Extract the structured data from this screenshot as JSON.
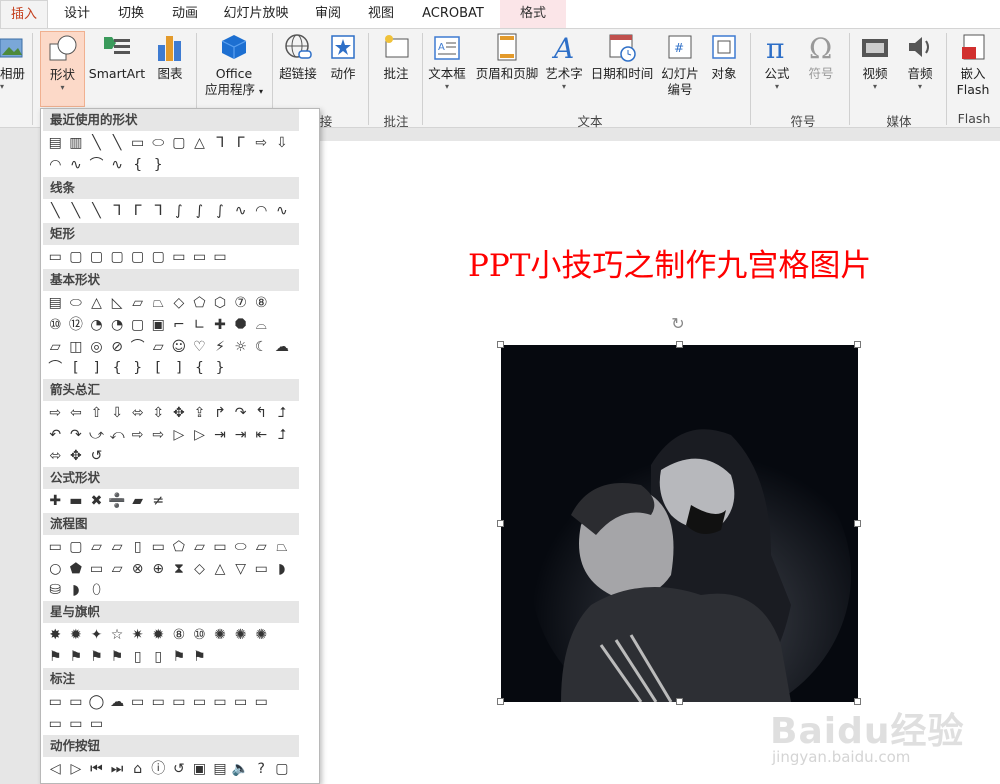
{
  "tabs": [
    {
      "label": "插入"
    },
    {
      "label": "设计"
    },
    {
      "label": "切换"
    },
    {
      "label": "动画"
    },
    {
      "label": "幻灯片放映"
    },
    {
      "label": "审阅"
    },
    {
      "label": "视图"
    },
    {
      "label": "ACROBAT"
    },
    {
      "label": "格式"
    }
  ],
  "ribbon": {
    "album": "相册",
    "shapes": "形状",
    "smartart": "SmartArt",
    "chart": "图表",
    "office_apps_1": "Office",
    "office_apps_2": "应用程序",
    "hyperlink": "超链接",
    "action": "动作",
    "comment": "批注",
    "textbox": "文本框",
    "header_footer": "页眉和页脚",
    "wordart": "艺术字",
    "datetime": "日期和时间",
    "slidenum_1": "幻灯片",
    "slidenum_2": "编号",
    "object": "对象",
    "equation": "公式",
    "symbol": "符号",
    "video": "视频",
    "audio": "音频",
    "embed_1": "嵌入",
    "embed_2": "Flash",
    "groups": {
      "links": "接",
      "comments": "批注",
      "text": "文本",
      "symbols": "符号",
      "media": "媒体",
      "flash": "Flash"
    }
  },
  "slide": {
    "title": "PPT小技巧之制作九宫格图片"
  },
  "watermark": {
    "logo": "Baidu经验",
    "url": "jingyan.baidu.com"
  },
  "shapes_panel": {
    "recent": {
      "title": "最近使用的形状",
      "rows": [
        "▤▥╲╲▭⬭▢△ᒣᒥ⇨⇩",
        "◠∿⌒∿{ }"
      ]
    },
    "lines": {
      "title": "线条",
      "rows": [
        "╲╲╲ᒣᒥᒣ∫∫∫∿◠∿"
      ]
    },
    "rect": {
      "title": "矩形",
      "rows": [
        "▭▢▢▢▢▢▭▭▭"
      ]
    },
    "basic": {
      "title": "基本形状",
      "rows": [
        "▤⬭△◺▱⏢◇⬠⬡⑦⑧",
        "⑩⑫◔◔▢▣⌐∟✚⯃⌓",
        "▱◫◎⊘⌒▱☺♡⚡☼☾☁",
        "⌒[ ]{}[ ]{ }"
      ]
    },
    "arrows": {
      "title": "箭头总汇",
      "rows": [
        "⇨⇦⇧⇩⬄⇳✥⇪↱↷↰⮥",
        "↶↷⤻⤺⇨⇨▷▷⇥⇥⇤⮥",
        "⬄✥↺"
      ]
    },
    "equation": {
      "title": "公式形状",
      "rows": [
        "✚▬✖➗▰≠"
      ]
    },
    "flowchart": {
      "title": "流程图",
      "rows": [
        "▭▢▱▱▯▭⬠▱▭⬭▱⏢",
        "○⬟▭▱⊗⊕⧗◇△▽▭◗",
        "⛁◗⬯"
      ]
    },
    "stars": {
      "title": "星与旗帜",
      "rows": [
        "✸✹✦☆✷✹⑧⑩✺✺✺",
        "⚑⚑⚑⚑▯▯⚑⚑"
      ]
    },
    "callouts": {
      "title": "标注",
      "rows": [
        "▭▭◯☁▭▭▭▭▭▭▭",
        "▭▭▭"
      ]
    },
    "actions": {
      "title": "动作按钮",
      "rows": [
        "◁▷⏮⏭⌂ⓘ↺▣▤🔈?▢"
      ]
    }
  }
}
